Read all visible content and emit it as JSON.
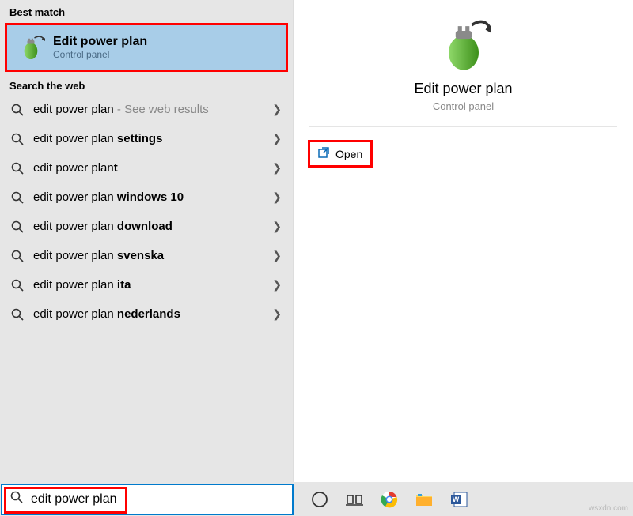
{
  "sections": {
    "best_match": "Best match",
    "search_web": "Search the web"
  },
  "best_match": {
    "title": "Edit power plan",
    "subtitle": "Control panel"
  },
  "web_results": [
    {
      "prefix": "edit power plan",
      "bold": "",
      "suffix": " - See web results"
    },
    {
      "prefix": "edit power plan ",
      "bold": "settings",
      "suffix": ""
    },
    {
      "prefix": "edit power plan",
      "bold": "t",
      "suffix": ""
    },
    {
      "prefix": "edit power plan ",
      "bold": "windows 10",
      "suffix": ""
    },
    {
      "prefix": "edit power plan ",
      "bold": "download",
      "suffix": ""
    },
    {
      "prefix": "edit power plan ",
      "bold": "svenska",
      "suffix": ""
    },
    {
      "prefix": "edit power plan ",
      "bold": "ita",
      "suffix": ""
    },
    {
      "prefix": "edit power plan ",
      "bold": "nederlands",
      "suffix": ""
    }
  ],
  "detail": {
    "title": "Edit power plan",
    "subtitle": "Control panel",
    "open": "Open"
  },
  "search_input": "edit power plan",
  "watermark": "wsxdn.com"
}
